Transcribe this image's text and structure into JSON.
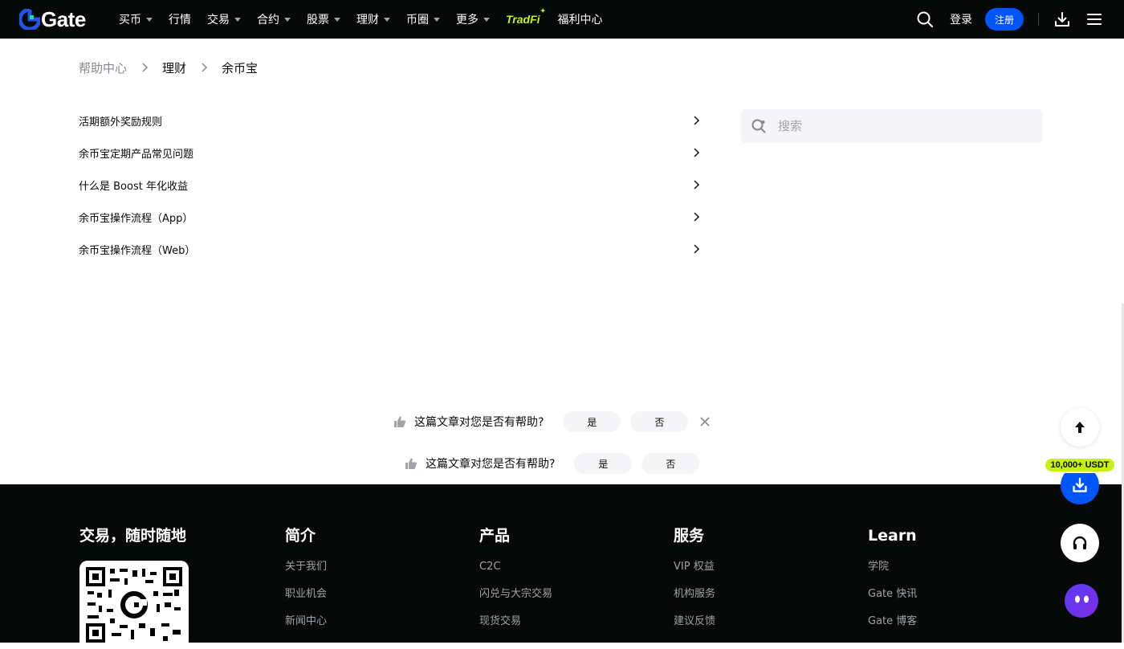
{
  "header": {
    "logo": "Gate",
    "nav": [
      {
        "label": "买币",
        "caret": true
      },
      {
        "label": "行情",
        "caret": false
      },
      {
        "label": "交易",
        "caret": true
      },
      {
        "label": "合约",
        "caret": true
      },
      {
        "label": "股票",
        "caret": true
      },
      {
        "label": "理财",
        "caret": true
      },
      {
        "label": "币圈",
        "caret": true
      },
      {
        "label": "更多",
        "caret": true
      }
    ],
    "tradfi": "TradFi",
    "welfare": "福利中心",
    "login": "登录",
    "register": "注册"
  },
  "breadcrumb": [
    "帮助中心",
    "理财",
    "余币宝"
  ],
  "articles": [
    "活期额外奖励规则",
    "余币宝定期产品常见问题",
    "什么是 Boost 年化收益",
    "余币宝操作流程（App）",
    "余币宝操作流程（Web）"
  ],
  "search": {
    "placeholder": "搜索"
  },
  "feedback": {
    "question": "这篇文章对您是否有帮助?",
    "yes": "是",
    "no": "否"
  },
  "footer": {
    "brand_title": "交易，随时随地",
    "columns": [
      {
        "title": "简介",
        "links": [
          "关于我们",
          "职业机会",
          "新闻中心"
        ]
      },
      {
        "title": "产品",
        "links": [
          "C2C",
          "闪兑与大宗交易",
          "现货交易"
        ]
      },
      {
        "title": "服务",
        "links": [
          "VIP 权益",
          "机构服务",
          "建议反馈"
        ]
      },
      {
        "title": "Learn",
        "links": [
          "学院",
          "Gate 快讯",
          "Gate 博客"
        ]
      }
    ]
  },
  "floating": {
    "usdt_badge": "10,000+ USDT"
  },
  "colors": {
    "brand_blue": "#0055ff",
    "accent_lime": "#c7f20d",
    "dark": "#070808"
  }
}
